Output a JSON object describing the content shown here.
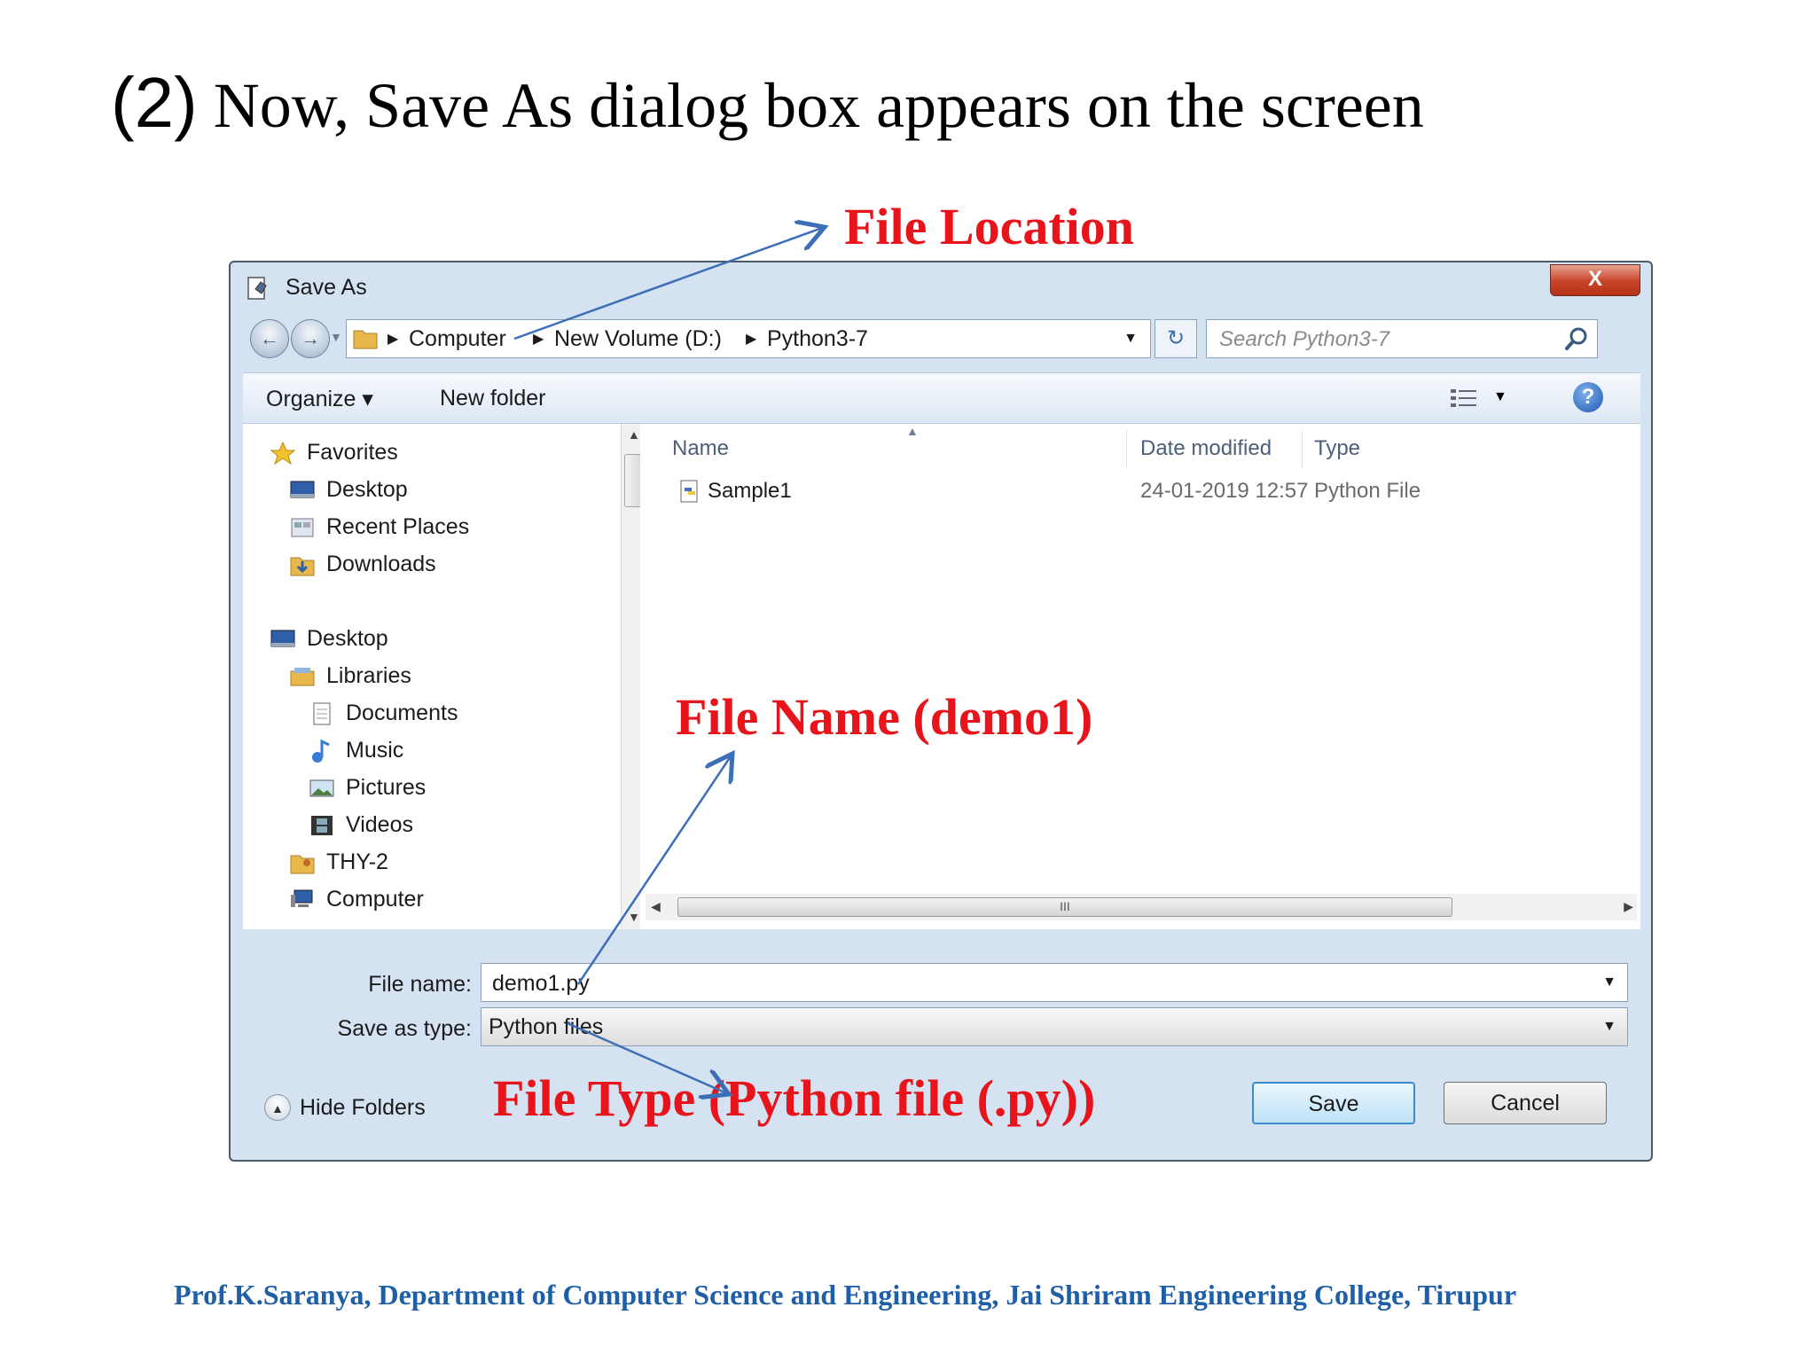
{
  "slide": {
    "title_num": "(2)",
    "title_text": "Now, Save As dialog box appears on the screen",
    "footer": "Prof.K.Saranya, Department of Computer Science and Engineering, Jai Shriram Engineering College, Tirupur"
  },
  "annotations": {
    "file_location": "File Location",
    "file_name": "File Name (demo1)",
    "file_type": "File Type (Python file (.py))"
  },
  "colors": {
    "annotation": "#e8141b",
    "arrow": "#3d6fb6",
    "footer": "#1f5fa8"
  },
  "dialog": {
    "title": "Save As",
    "close": "X",
    "address": {
      "crumbs": [
        "Computer",
        "New Volume (D:)",
        "Python3-7"
      ]
    },
    "search": {
      "placeholder": "Search Python3-7"
    },
    "toolbar": {
      "organize": "Organize ▾",
      "new_folder": "New folder"
    },
    "nav": {
      "favorites": "Favorites",
      "desktop_fav": "Desktop",
      "recent_places": "Recent Places",
      "downloads": "Downloads",
      "desktop": "Desktop",
      "libraries": "Libraries",
      "documents": "Documents",
      "music": "Music",
      "pictures": "Pictures",
      "videos": "Videos",
      "thy2": "THY-2",
      "computer": "Computer"
    },
    "columns": {
      "name": "Name",
      "date": "Date modified",
      "type": "Type"
    },
    "files": [
      {
        "name": "Sample1",
        "date": "24-01-2019 12:57",
        "type": "Python File"
      }
    ],
    "scroll_mark": "III",
    "form": {
      "file_name_label": "File name:",
      "file_name_value": "demo1.py",
      "save_type_label": "Save as type:",
      "save_type_value": "Python files"
    },
    "hide_folders": "Hide Folders",
    "save": "Save",
    "cancel": "Cancel"
  }
}
